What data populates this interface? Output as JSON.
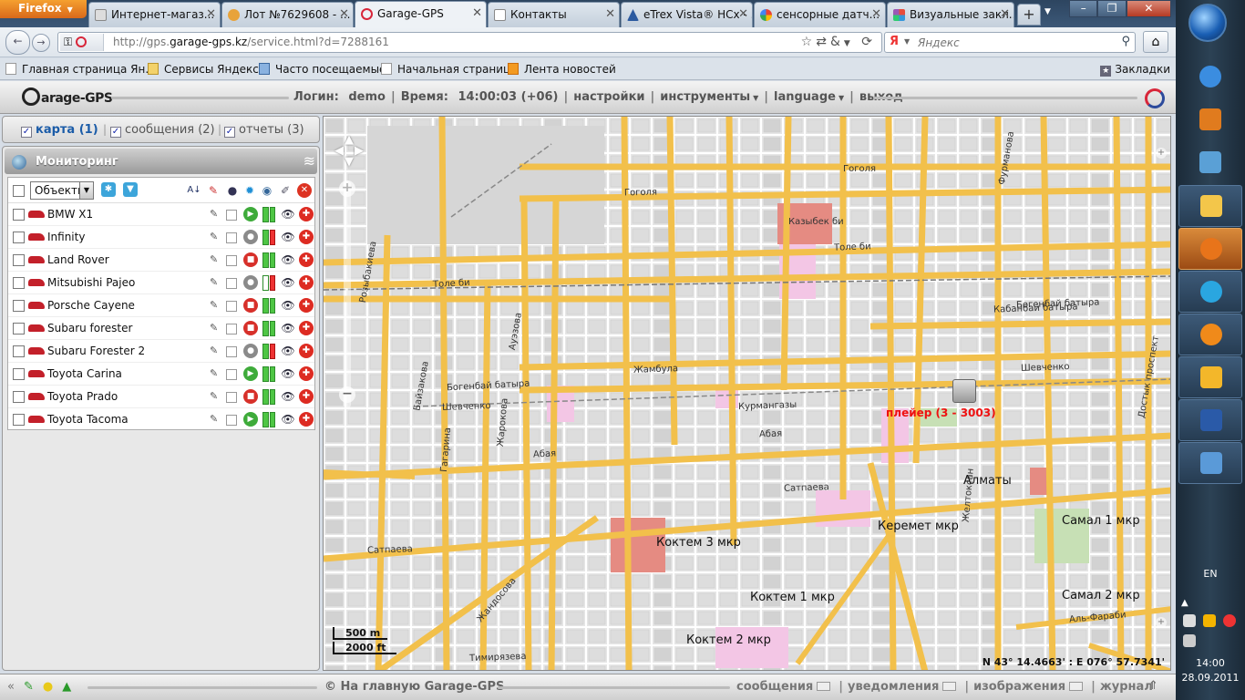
{
  "browser": {
    "app_button": "Firefox",
    "tabs": [
      {
        "label": "Интернет-магаз...",
        "icon_color": "#dddddd"
      },
      {
        "label": "Лот №7629608 - ...",
        "icon_color": "#e8a33a"
      },
      {
        "label": "Garage-GPS",
        "icon_color": "#d8263a"
      },
      {
        "label": "Контакты",
        "icon_color": "#ffffff"
      },
      {
        "label": "eTrex Vista® HCx - ...",
        "icon_color": "#2c5aa0"
      },
      {
        "label": "сенсорные датч...",
        "icon_color": "#4285f4"
      },
      {
        "label": "Визуальные закл...",
        "icon_color": "#9b59b6"
      }
    ],
    "new_tab": "+",
    "url": {
      "prefix": "http://gps.",
      "host": "garage-gps.kz",
      "path": "/service.html?d=7288161"
    },
    "search": {
      "engine": "Я",
      "placeholder": "Яндекс"
    },
    "bookmarks": [
      {
        "label": "Главная страница Ян...",
        "icon": "page-icon"
      },
      {
        "label": "Сервисы Яндекса",
        "icon": "folder-icon"
      },
      {
        "label": "Часто посещаемые",
        "icon": "smart-folder-icon"
      },
      {
        "label": "Начальная страница",
        "icon": "page-icon"
      },
      {
        "label": "Лента новостей",
        "icon": "rss-icon"
      }
    ],
    "bookmarks_menu": "Закладки"
  },
  "app": {
    "logo": "arage-GPS",
    "header": {
      "login_label": "Логин:",
      "login_value": "demo",
      "time_label": "Время:",
      "time_value": "14:00:03 (+06)",
      "menu": [
        "настройки",
        "инструменты",
        "language",
        "выход"
      ]
    },
    "view_tabs": [
      {
        "label": "карта (1)",
        "checked": true,
        "active": true
      },
      {
        "label": "сообщения (2)",
        "checked": true,
        "active": false
      },
      {
        "label": "отчеты (3)",
        "checked": true,
        "active": false
      }
    ],
    "monitoring": {
      "title": "Мониторинг",
      "filter_value": "Объекты",
      "objects": [
        {
          "name": "BMW X1",
          "status": "green",
          "signal": [
            "g",
            "g"
          ]
        },
        {
          "name": "Infinity",
          "status": "grey",
          "signal": [
            "g",
            "r"
          ]
        },
        {
          "name": "Land Rover",
          "status": "red",
          "signal": [
            "g",
            "g"
          ]
        },
        {
          "name": "Mitsubishi Pajeo",
          "status": "grey",
          "signal": [
            "w",
            "r"
          ]
        },
        {
          "name": "Porsche Cayene",
          "status": "red",
          "signal": [
            "g",
            "g"
          ]
        },
        {
          "name": "Subaru forester",
          "status": "red",
          "signal": [
            "g",
            "g"
          ]
        },
        {
          "name": "Subaru Forester 2",
          "status": "grey",
          "signal": [
            "g",
            "r"
          ]
        },
        {
          "name": "Toyota Carina",
          "status": "green",
          "signal": [
            "g",
            "g"
          ]
        },
        {
          "name": "Toyota Prado",
          "status": "red",
          "signal": [
            "g",
            "g"
          ]
        },
        {
          "name": "Toyota Tacoma",
          "status": "green",
          "signal": [
            "g",
            "g"
          ]
        }
      ]
    },
    "map": {
      "city_label": "Алматы",
      "streets": [
        "Толе би",
        "Гоголя",
        "Абая",
        "Сатпаева",
        "Жандосова",
        "Богенбай батыра",
        "Жамбула",
        "Шевченко",
        "Казыбек би",
        "Кабанбай батыра",
        "Курмангазы",
        "Тимирязева",
        "Розыбакиева",
        "Аль-Фараби",
        "Байзакова",
        "Гагарина",
        "Ауэзова",
        "Жарокова",
        "Желтоксан",
        "Достык проспект",
        "Фурманова"
      ],
      "districts": [
        "Коктем 3 мкр",
        "Коктем 1 мкр",
        "Коктем 2 мкр",
        "Керемет мкр",
        "Самал 1 мкр",
        "Самал 2 мкр"
      ],
      "vehicle_label": "плейер (3 - 3003)",
      "scale_m": "500 m",
      "scale_ft": "2000 ft",
      "coords": "N 43° 14.4663' : E 076° 57.7341'"
    },
    "footer": {
      "home": "© На главную Garage-GPS",
      "links": [
        "сообщения",
        "уведомления",
        "изображения",
        "журнал"
      ]
    }
  },
  "taskbar": {
    "lang": "EN",
    "time": "14:00",
    "date": "28.09.2011",
    "apps": [
      "ie-icon",
      "media-player-icon",
      "calculator-icon",
      "explorer-icon",
      "firefox-icon",
      "skype-icon",
      "mail-agent-icon",
      "outlook-icon",
      "word-icon",
      "photo-viewer-icon"
    ]
  },
  "colors": {
    "accent": "#1b5ca8",
    "road": "#f2c04b",
    "status_green": "#3eab3a",
    "status_red": "#d7302a"
  }
}
